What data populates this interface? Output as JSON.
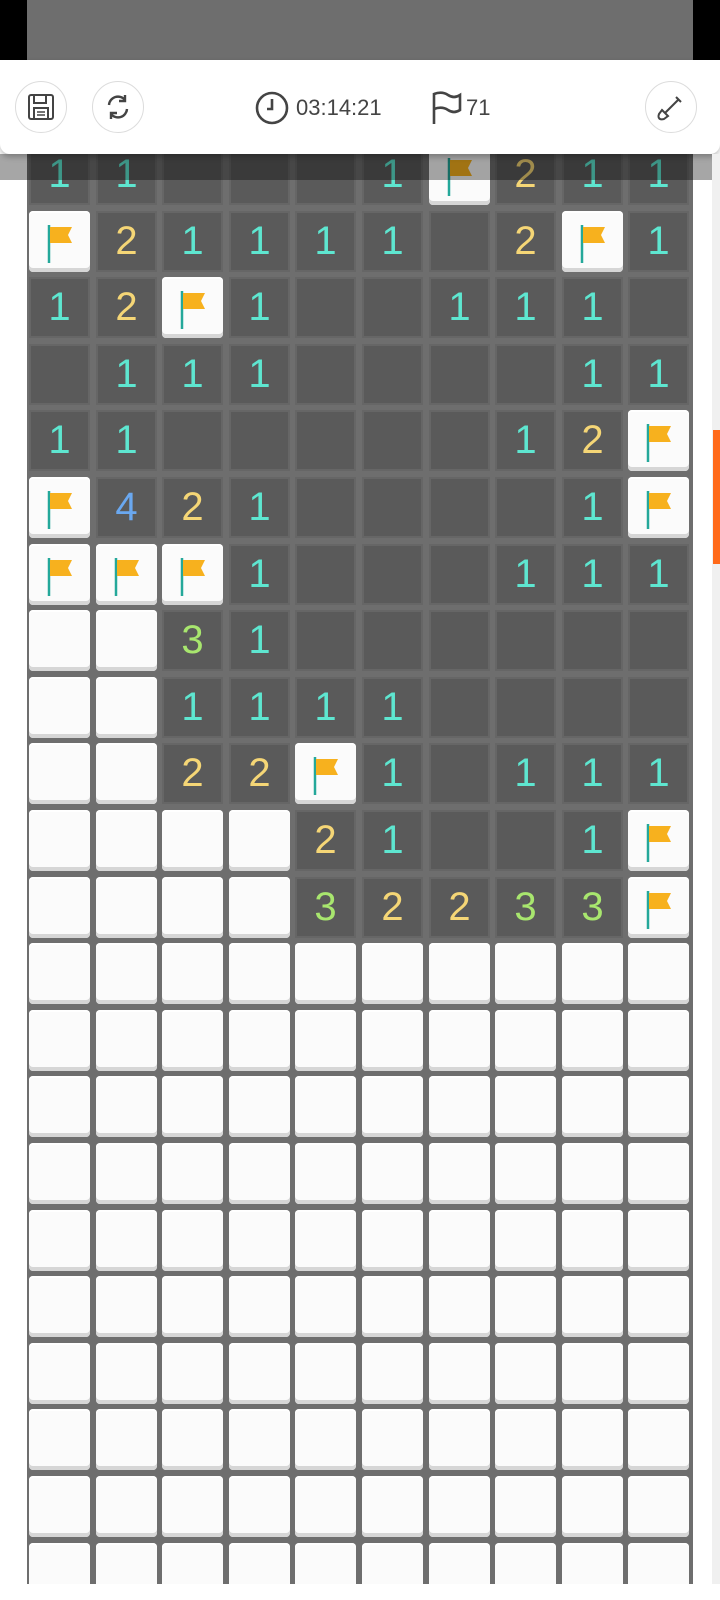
{
  "toolbar": {
    "save_icon": "save-icon",
    "restart_icon": "restart-icon",
    "timer_icon": "clock-icon",
    "timer": "03:14:21",
    "flags_icon": "flag-outline-icon",
    "flags_remaining": "71",
    "dig_icon": "shovel-icon"
  },
  "colors": {
    "covered": "#fbfbfb",
    "revealed": "#5a5a5a",
    "grid": "#6e6e6e",
    "n1": "#5ee6d0",
    "n2": "#f5d676",
    "n3": "#a8e66e",
    "n4": "#6aa8f0",
    "flag": "#f7b11e",
    "flag_pole": "#24a89a",
    "scroll_thumb": "#ff6a1a"
  },
  "board": {
    "cols": 10,
    "legend": "C = covered, F = flagged, 0 = revealed empty, 1-9 = revealed number",
    "rows": [
      "1100 1F2110",
      "F21111 2F10",
      "12F1001110",
      "0111000011",
      "110000012F",
      "F421000 1F2",
      "FFF1000111",
      "CC31000000",
      "CC11110000",
      "CC22F10111",
      "CCCC210 1F2",
      "CCCC32233F",
      "CCCCCCCCCC",
      "CCCCCCCCCC",
      "CCCCCCCCCC",
      "CCCCCCCCCC",
      "CCCCCCCCCC",
      "CCCCCCCCCC",
      "CCCCCCCCCC",
      "CCCCCCCCCC",
      "CCCCCCCCCC",
      "CCCCCCCCCC"
    ]
  }
}
